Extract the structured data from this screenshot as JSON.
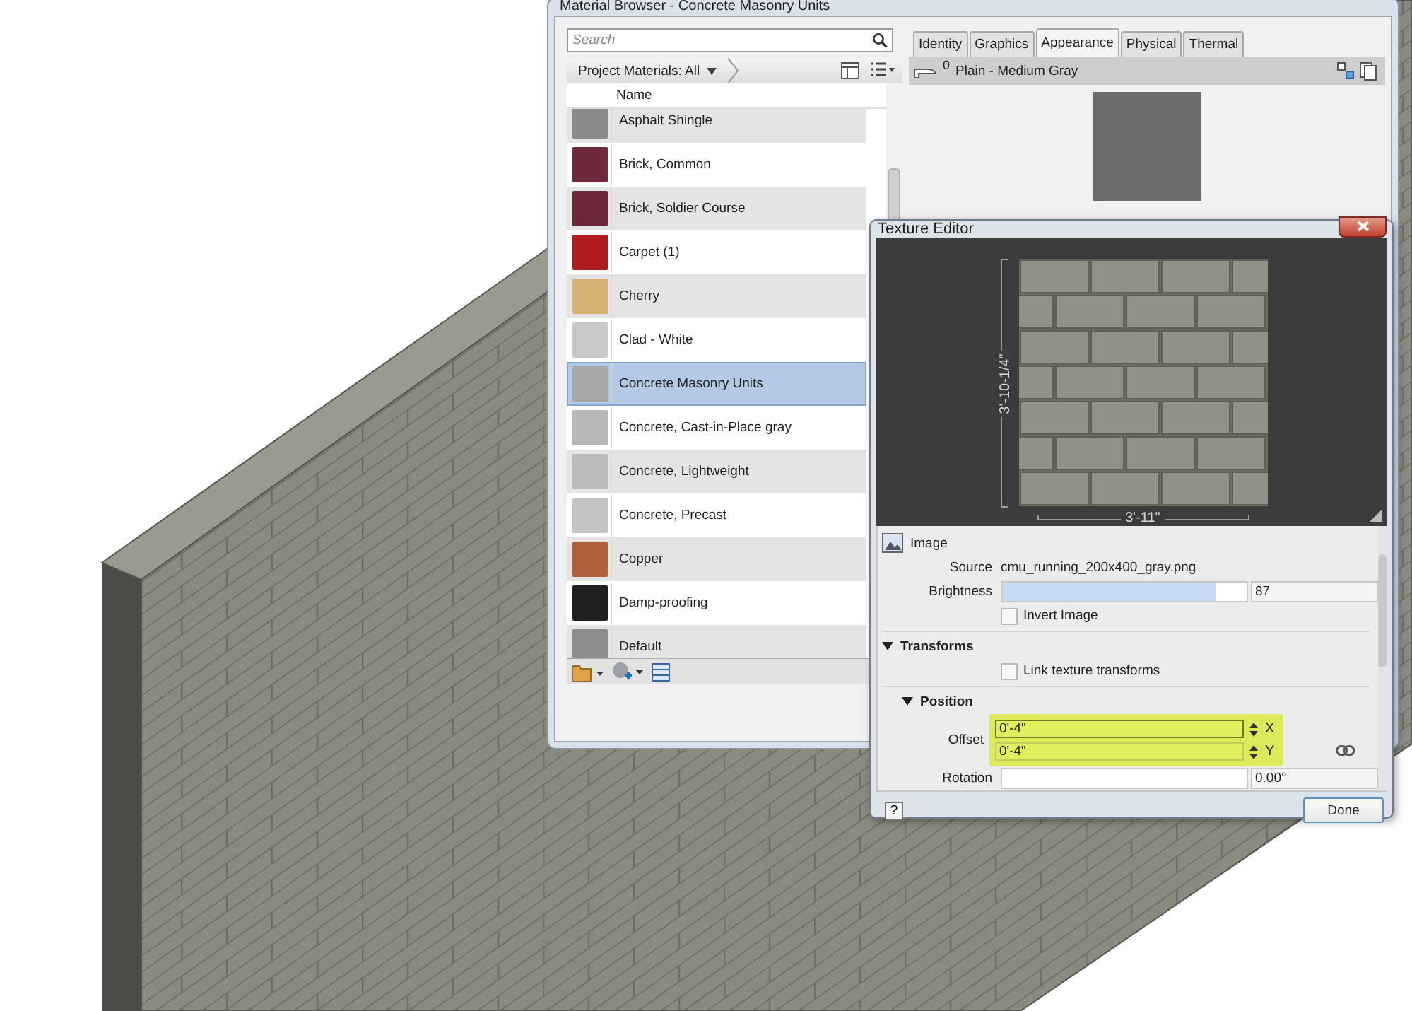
{
  "material_browser": {
    "title": "Material Browser - Concrete Masonry Units",
    "search": {
      "placeholder": "Search"
    },
    "filter": "Project Materials: All",
    "list_header": "Name",
    "materials": [
      {
        "name": "Asphalt Shingle",
        "color": "#8a8a8a",
        "selected": false
      },
      {
        "name": "Brick, Common",
        "color": "#6e2a3c",
        "selected": false
      },
      {
        "name": "Brick, Soldier Course",
        "color": "#6a2838",
        "selected": false
      },
      {
        "name": "Carpet (1)",
        "color": "#b01c1c",
        "selected": false
      },
      {
        "name": "Cherry",
        "color": "#d8b070",
        "selected": false
      },
      {
        "name": "Clad - White",
        "color": "#c8c8c8",
        "selected": false
      },
      {
        "name": "Concrete Masonry Units",
        "color": "#a8a8a8",
        "selected": true
      },
      {
        "name": "Concrete, Cast-in-Place gray",
        "color": "#b8b8b8",
        "selected": false
      },
      {
        "name": "Concrete, Lightweight",
        "color": "#bcbcbc",
        "selected": false
      },
      {
        "name": "Concrete, Precast",
        "color": "#c4c4c4",
        "selected": false
      },
      {
        "name": "Copper",
        "color": "#b0603a",
        "selected": false
      },
      {
        "name": "Damp-proofing",
        "color": "#202020",
        "selected": false
      },
      {
        "name": "Default",
        "color": "#8c8c8c",
        "selected": false
      }
    ],
    "tabs": [
      {
        "label": "Identity",
        "selected": false
      },
      {
        "label": "Graphics",
        "selected": false
      },
      {
        "label": "Appearance",
        "selected": true
      },
      {
        "label": "Physical",
        "selected": false
      },
      {
        "label": "Thermal",
        "selected": false
      }
    ],
    "asset": {
      "usage_count": "0",
      "name": "Plain - Medium Gray"
    }
  },
  "texture_editor": {
    "title": "Texture Editor",
    "height_dimension": "3'-10-1/4\"",
    "width_dimension": "3'-11\"",
    "image_section": "Image",
    "source_label": "Source",
    "source": "cmu_running_200x400_gray.png",
    "brightness": {
      "label": "Brightness",
      "level": 0.87,
      "reading": "87"
    },
    "invert": {
      "label": "Invert Image",
      "checked": false
    },
    "transforms": {
      "label": "Transforms",
      "expanded": true
    },
    "link": {
      "label": "Link texture transforms",
      "checked": false
    },
    "position": {
      "label": "Position",
      "expanded": true,
      "highlighted": true
    },
    "offset_label": "Offset",
    "offset_x": {
      "value": "0'-4\"",
      "axis": "X"
    },
    "offset_y": {
      "value": "0'-4\"",
      "axis": "Y"
    },
    "rotation": {
      "label": "Rotation",
      "level": 0,
      "reading": "0.00°"
    },
    "help": "?",
    "done": "Done"
  }
}
